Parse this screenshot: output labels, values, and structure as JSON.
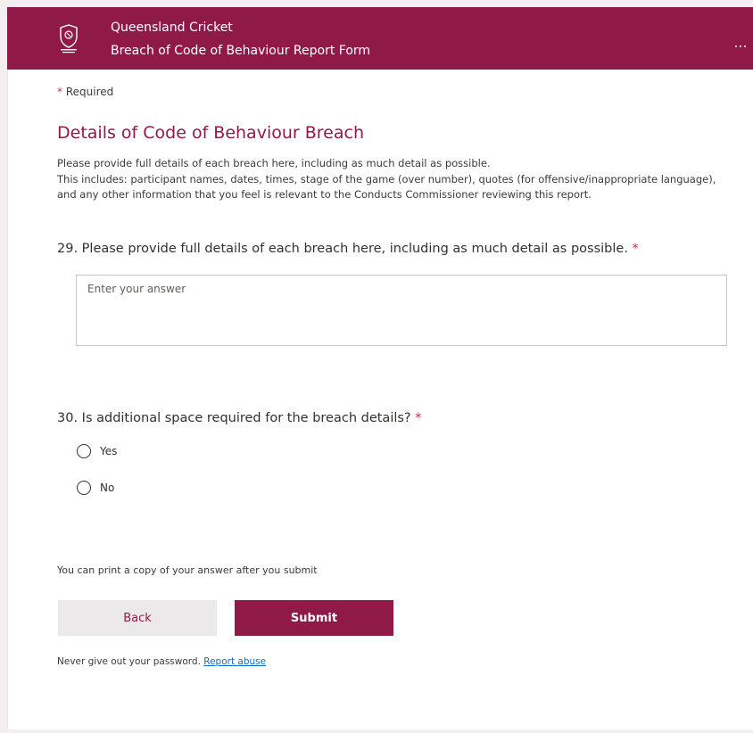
{
  "header": {
    "org_name": "Queensland Cricket",
    "form_title": "Breach of Code of Behaviour Report Form",
    "logo_icon": "queensland-cricket-crest",
    "more_icon": "ellipsis-icon",
    "background_color": "#8f1a48"
  },
  "required_note": {
    "asterisk": "*",
    "label": "Required"
  },
  "section": {
    "title": "Details of Code of Behaviour Breach",
    "description_line1": "Please provide full details of each breach here, including as much detail as possible.",
    "description_line2": "This includes: participant names, dates, times, stage of the game (over number), quotes (for offensive/inappropriate language), and any other information that you feel is relevant to the Conducts Commissioner reviewing this report."
  },
  "questions": [
    {
      "number": "29.",
      "text": "Please provide full details of each breach here, including as much detail as possible.",
      "required_mark": "*",
      "placeholder": "Enter your answer",
      "value": ""
    },
    {
      "number": "30.",
      "text": "Is additional space required for the breach details?",
      "required_mark": "*",
      "options": [
        {
          "label": "Yes",
          "selected": false
        },
        {
          "label": "No",
          "selected": false
        }
      ]
    }
  ],
  "print_note": "You can print a copy of your answer after you submit",
  "buttons": {
    "back_label": "Back",
    "submit_label": "Submit"
  },
  "footer": {
    "password_warning": "Never give out your password.",
    "report_link": "Report abuse"
  },
  "colors": {
    "accent": "#8f1a48",
    "required": "#c4314b",
    "link": "#0f6cbd"
  }
}
